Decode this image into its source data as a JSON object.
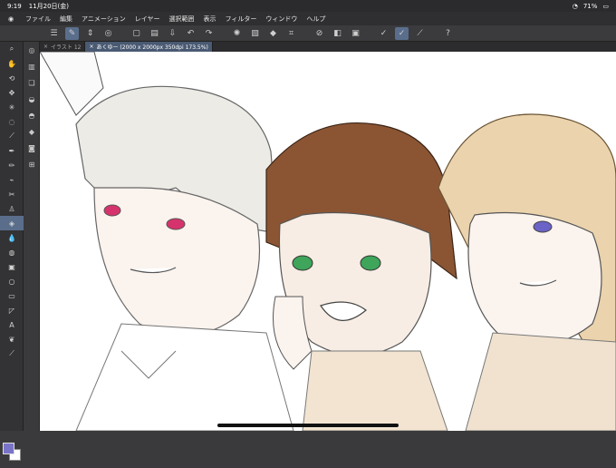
{
  "status": {
    "time": "9:19",
    "date": "11月20日(金)",
    "battery": "71%"
  },
  "menu": [
    "ファイル",
    "編集",
    "アニメーション",
    "レイヤー",
    "選択範囲",
    "表示",
    "フィルター",
    "ウィンドウ",
    "ヘルプ"
  ],
  "tabs": [
    {
      "label": "イラスト 12"
    },
    {
      "label": "あくゆー (2000 x 2000px 350dpi 173.5%)"
    }
  ],
  "colors": {
    "fg": "#7a74c8",
    "bg": "#ffffff",
    "accent": "#5a6e8c"
  },
  "tools": [
    "zoom-icon",
    "hand-icon",
    "rotate-icon",
    "move-icon",
    "select-icon",
    "lasso-icon",
    "eyedropper-icon",
    "pen-icon",
    "pencil-icon",
    "brush-icon",
    "airbrush-icon",
    "eraser-icon",
    "blend-icon",
    "fill-icon",
    "gradient-icon",
    "shape-icon",
    "frame-icon",
    "ruler-icon",
    "text-icon",
    "balloon-icon",
    "line-icon"
  ],
  "subtools": [
    "layer-icon",
    "copy-icon",
    "stack-icon",
    "fill-layer-icon",
    "clear-icon",
    "camera-icon",
    "save-icon"
  ]
}
